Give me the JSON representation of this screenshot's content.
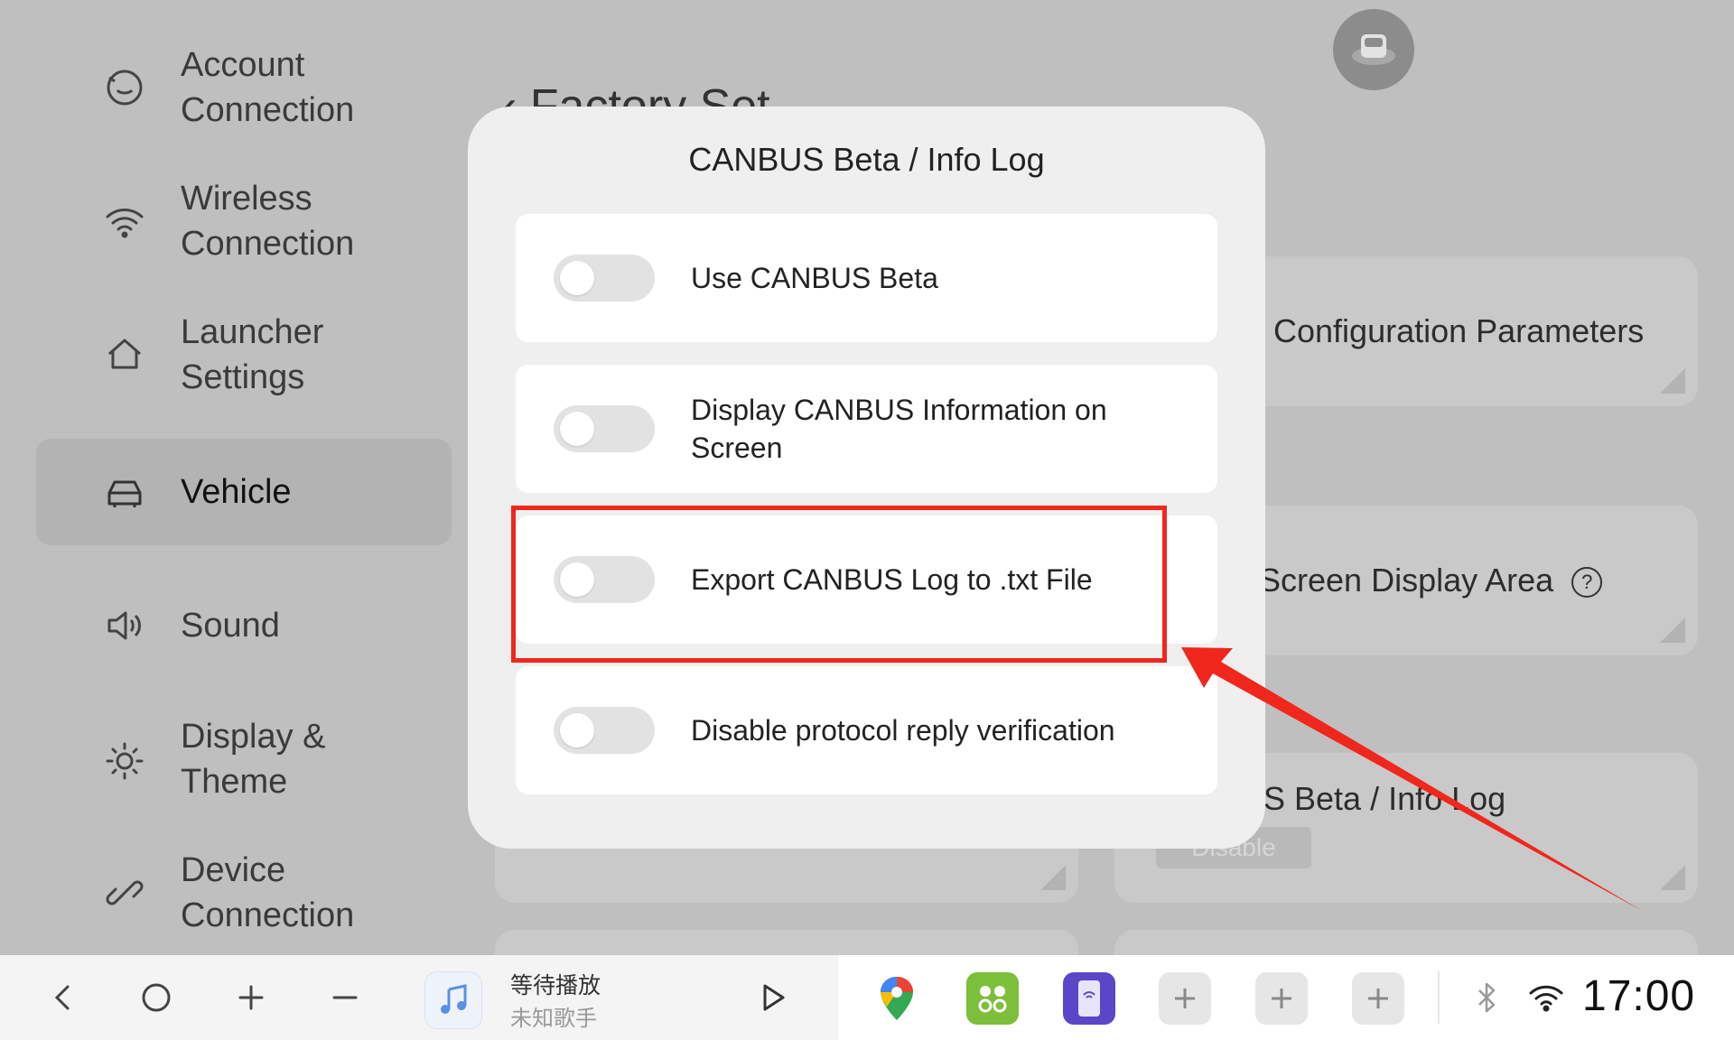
{
  "sidebar": {
    "items": [
      {
        "label": "Account\nConnection",
        "icon": "account-connection-icon"
      },
      {
        "label": "Wireless\nConnection",
        "icon": "wifi-icon"
      },
      {
        "label": "Launcher\nSettings",
        "icon": "home-icon"
      },
      {
        "label": "Vehicle",
        "icon": "car-icon",
        "active": true
      },
      {
        "label": "Sound",
        "icon": "speaker-icon"
      },
      {
        "label": "Display &\nTheme",
        "icon": "brightness-icon"
      },
      {
        "label": "Device\nConnection",
        "icon": "link-icon"
      }
    ]
  },
  "background": {
    "page_title": "Factory Set",
    "cards": {
      "config_params": "Configuration Parameters",
      "screen_display_area": "Screen Display Area",
      "canbus_beta": "S Beta / Info Log",
      "disable_label": "Disable"
    }
  },
  "modal": {
    "title": "CANBUS Beta / Info Log",
    "options": [
      {
        "label": "Use CANBUS Beta",
        "enabled": false
      },
      {
        "label": "Display CANBUS Information on Screen",
        "enabled": false
      },
      {
        "label": "Export CANBUS Log to .txt File",
        "enabled": false
      },
      {
        "label": "Disable protocol reply verification",
        "enabled": false
      }
    ],
    "highlight_color": "#f0271c"
  },
  "taskbar": {
    "music": {
      "title": "等待播放",
      "artist": "未知歌手"
    },
    "clock": "17:00",
    "apps": [
      "google-maps-icon",
      "app-grid-icon",
      "phone-link-icon"
    ]
  }
}
